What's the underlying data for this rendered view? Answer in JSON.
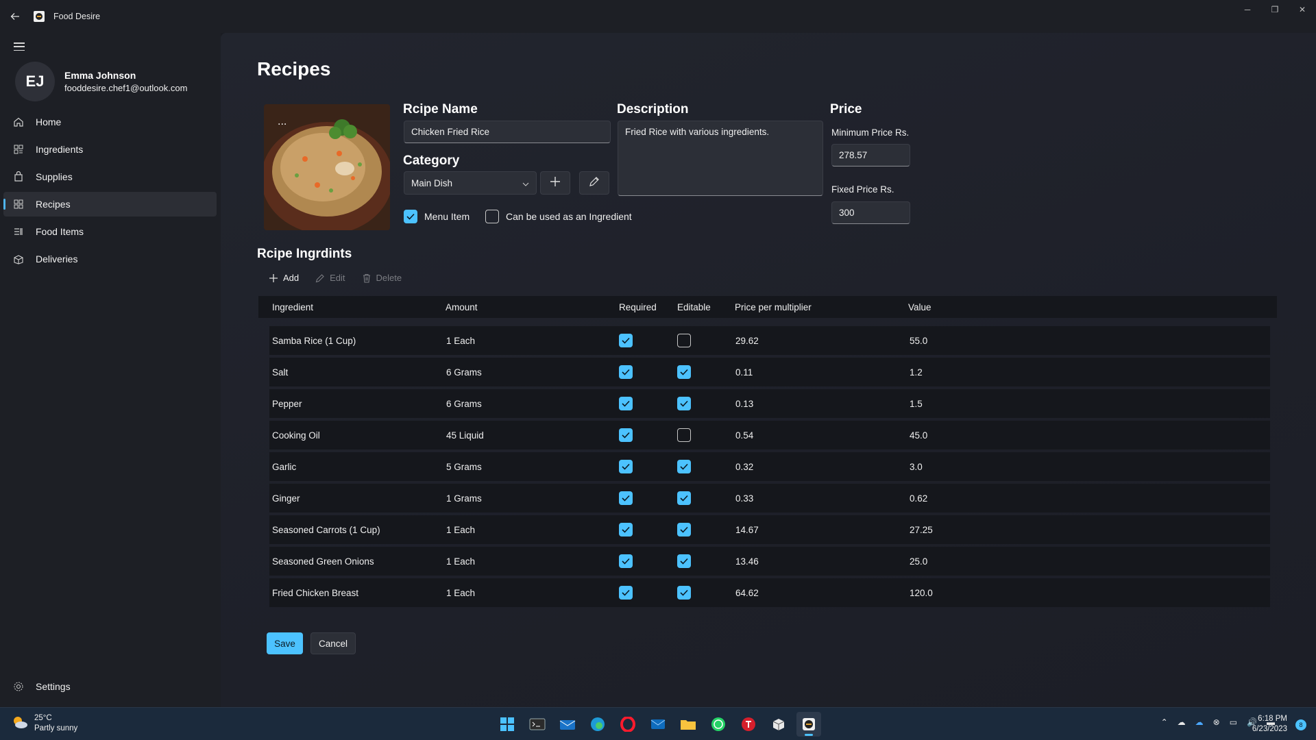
{
  "app": {
    "title": "Food Desire"
  },
  "user": {
    "initials": "EJ",
    "name": "Emma Johnson",
    "email": "fooddesire.chef1@outlook.com"
  },
  "nav": {
    "items": [
      {
        "label": "Home",
        "icon": "home-icon"
      },
      {
        "label": "Ingredients",
        "icon": "ingredients-icon"
      },
      {
        "label": "Supplies",
        "icon": "supplies-icon"
      },
      {
        "label": "Recipes",
        "icon": "recipes-icon",
        "active": true
      },
      {
        "label": "Food Items",
        "icon": "food-items-icon"
      },
      {
        "label": "Deliveries",
        "icon": "deliveries-icon"
      }
    ],
    "settings_label": "Settings"
  },
  "page": {
    "title": "Recipes",
    "recipe_name_label": "Rcipe Name",
    "recipe_name_value": "Chicken Fried Rice",
    "category_label": "Category",
    "category_value": "Main Dish",
    "menu_item_label": "Menu Item",
    "menu_item_checked": true,
    "ingredient_use_label": "Can be used as an Ingredient",
    "ingredient_use_checked": false,
    "description_label": "Description",
    "description_value": "Fried Rice with various ingredients.",
    "price_label": "Price",
    "min_price_label": "Minimum Price Rs.",
    "min_price_value": "278.57",
    "fixed_price_label": "Fixed Price Rs.",
    "fixed_price_value": "300",
    "ingredients_section_label": "Rcipe Ingrdints"
  },
  "toolbar": {
    "add_label": "Add",
    "edit_label": "Edit",
    "delete_label": "Delete"
  },
  "table": {
    "headers": [
      "Ingredient",
      "Amount",
      "Required",
      "Editable",
      "Price per multiplier",
      "Value"
    ],
    "rows": [
      {
        "ingredient": "Samba Rice (1 Cup)",
        "amount": "1 Each",
        "required": true,
        "editable": false,
        "price": "29.62",
        "value": "55.0"
      },
      {
        "ingredient": "Salt",
        "amount": "6 Grams",
        "required": true,
        "editable": true,
        "price": "0.11",
        "value": "1.2"
      },
      {
        "ingredient": "Pepper",
        "amount": "6 Grams",
        "required": true,
        "editable": true,
        "price": "0.13",
        "value": "1.5"
      },
      {
        "ingredient": "Cooking Oil",
        "amount": "45 Liquid",
        "required": true,
        "editable": false,
        "price": "0.54",
        "value": "45.0"
      },
      {
        "ingredient": "Garlic",
        "amount": "5 Grams",
        "required": true,
        "editable": true,
        "price": "0.32",
        "value": "3.0"
      },
      {
        "ingredient": "Ginger",
        "amount": "1 Grams",
        "required": true,
        "editable": true,
        "price": "0.33",
        "value": "0.62"
      },
      {
        "ingredient": "Seasoned Carrots (1 Cup)",
        "amount": "1 Each",
        "required": true,
        "editable": true,
        "price": "14.67",
        "value": "27.25"
      },
      {
        "ingredient": "Seasoned Green Onions",
        "amount": "1 Each",
        "required": true,
        "editable": true,
        "price": "13.46",
        "value": "25.0"
      },
      {
        "ingredient": "Fried Chicken Breast",
        "amount": "1 Each",
        "required": true,
        "editable": true,
        "price": "64.62",
        "value": "120.0"
      }
    ]
  },
  "actions": {
    "save_label": "Save",
    "cancel_label": "Cancel"
  },
  "taskbar": {
    "weather_temp": "25°C",
    "weather_desc": "Partly sunny",
    "time": "6:18 PM",
    "date": "6/23/2023",
    "notification_count": "8"
  },
  "colors": {
    "accent": "#4cc2ff",
    "background": "#1e2029",
    "sidebar": "#1d1f25"
  }
}
